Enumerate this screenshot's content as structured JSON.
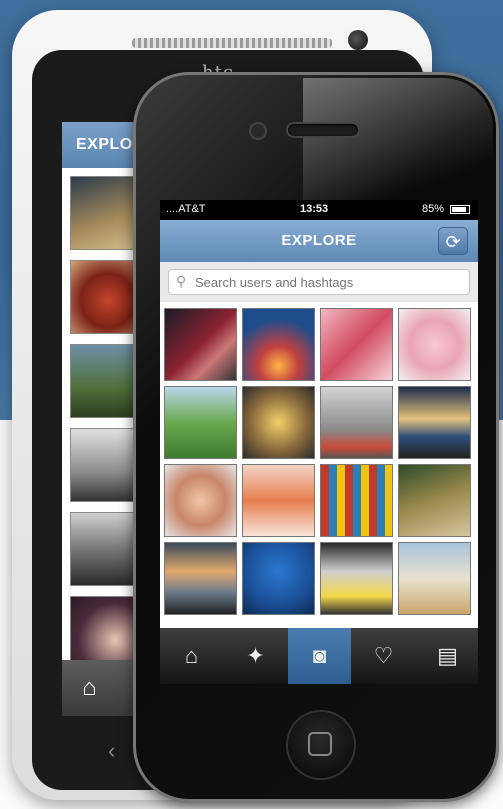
{
  "back_phone": {
    "brand": "htc",
    "header_title": "EXPLORE",
    "home_icon": "home-icon",
    "back_icon": "back-arrow-icon"
  },
  "front_phone": {
    "status_bar": {
      "carrier": "....AT&T",
      "time": "13:53",
      "battery": "85%"
    },
    "nav_bar": {
      "title": "EXPLORE",
      "refresh_icon": "refresh-icon"
    },
    "search": {
      "placeholder": "Search users and hashtags",
      "icon": "search-icon"
    },
    "tabs": [
      {
        "name": "home",
        "icon": "home-icon",
        "active": false
      },
      {
        "name": "explore",
        "icon": "compass-icon",
        "active": false
      },
      {
        "name": "camera",
        "icon": "camera-icon",
        "active": true
      },
      {
        "name": "news",
        "icon": "speech-bubble-heart-icon",
        "active": false
      },
      {
        "name": "profile",
        "icon": "profile-card-icon",
        "active": false
      }
    ]
  },
  "colors": {
    "accent_blue": "#5d88b5",
    "background_blue": "#3f6f9c"
  }
}
